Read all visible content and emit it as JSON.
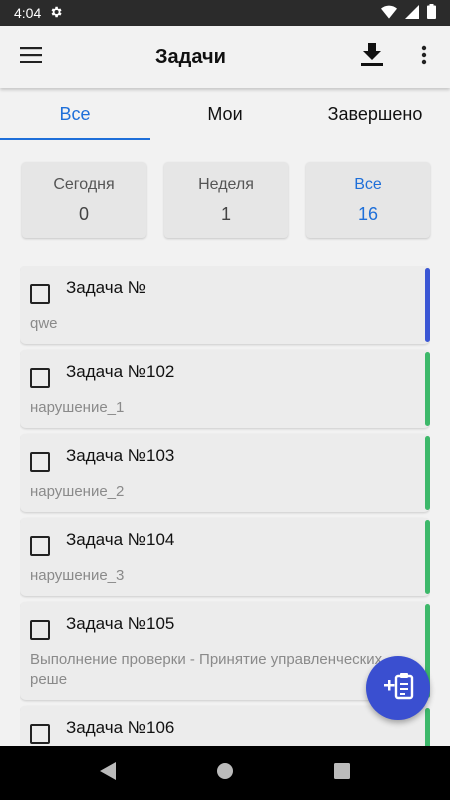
{
  "status_bar": {
    "time": "4:04"
  },
  "app_bar": {
    "title": "Задачи"
  },
  "tabs": [
    {
      "label": "Все",
      "active": true
    },
    {
      "label": "Мои",
      "active": false
    },
    {
      "label": "Завершено",
      "active": false
    }
  ],
  "counters": [
    {
      "label": "Сегодня",
      "value": "0",
      "active": false
    },
    {
      "label": "Неделя",
      "value": "1",
      "active": false
    },
    {
      "label": "Все",
      "value": "16",
      "active": true
    }
  ],
  "tasks": [
    {
      "title": "Задача №",
      "description": "qwe",
      "stripe_color": "#3a56d4"
    },
    {
      "title": "Задача №102",
      "description": "нарушение_1",
      "stripe_color": "#3db86a"
    },
    {
      "title": "Задача №103",
      "description": "нарушение_2",
      "stripe_color": "#3db86a"
    },
    {
      "title": "Задача №104",
      "description": "нарушение_3",
      "stripe_color": "#3db86a"
    },
    {
      "title": "Задача №105",
      "description": "Выполнение проверки - Принятие управленческих реше",
      "stripe_color": "#3db86a"
    },
    {
      "title": "Задача №106",
      "description": "",
      "stripe_color": "#3db86a"
    }
  ],
  "colors": {
    "accent": "#1e6fd9",
    "fab": "#3a4fd0"
  },
  "icons": {
    "menu": "menu-icon",
    "download": "download-icon",
    "more": "more-vert-icon",
    "fab": "add-task-icon",
    "settings": "gear-icon",
    "wifi": "wifi-icon",
    "signal": "signal-icon",
    "battery": "battery-icon"
  }
}
